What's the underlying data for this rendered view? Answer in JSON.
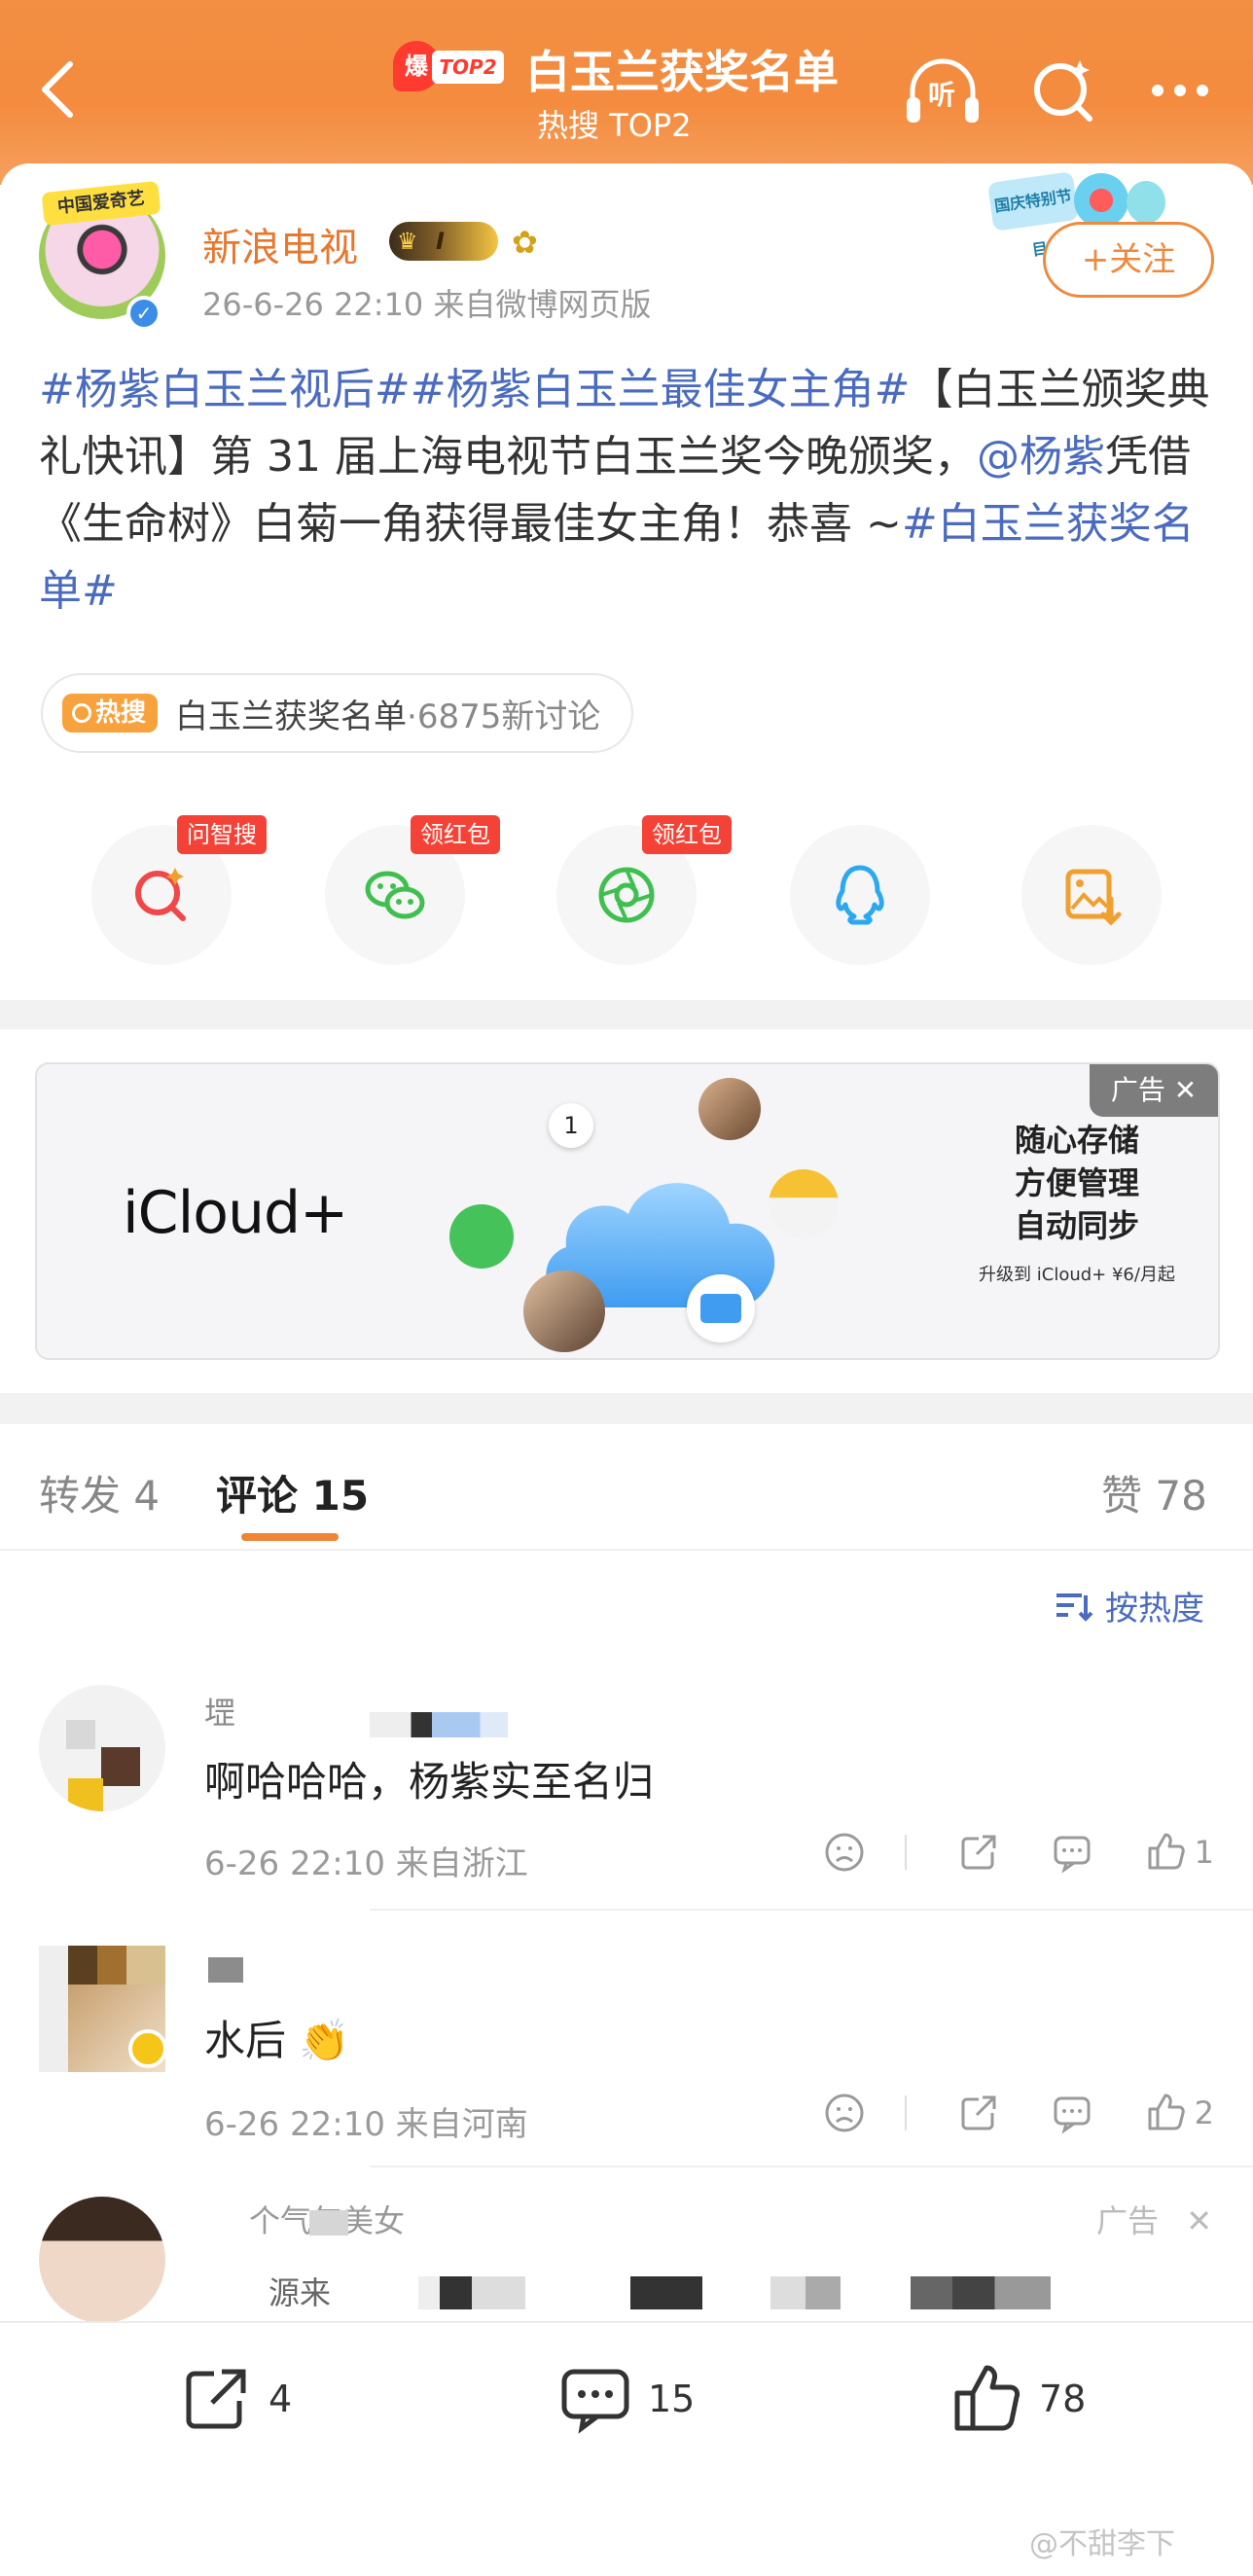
{
  "header": {
    "hot_badge": "爆",
    "hot_rank_tag": "TOP2",
    "title": "白玉兰获奖名单",
    "subtitle": "热搜 TOP2",
    "listen_label": "听"
  },
  "post": {
    "avatar_tag": "中国爱奇艺",
    "username": "新浪电视",
    "level": "I",
    "time_source": "26-6-26 22:10  来自微博网页版",
    "follow_label": "+关注",
    "sticker_text": "国庆特别节目",
    "text_segments": [
      {
        "type": "topic",
        "text": "#杨紫白玉兰视后#"
      },
      {
        "type": "topic",
        "text": "#杨紫白玉兰最佳女主角#"
      },
      {
        "type": "plain",
        "text": "【白玉兰颁奖典礼快讯】第 31 届上海电视节白玉兰奖今晚颁奖，"
      },
      {
        "type": "topic",
        "text": "@杨紫"
      },
      {
        "type": "plain",
        "text": "凭借《生命树》白菊一角获得最佳女主角！恭喜 ~"
      },
      {
        "type": "topic",
        "text": "#白玉兰获奖名单#"
      }
    ],
    "hot_chip": {
      "tag": "热搜",
      "text": "白玉兰获奖名单",
      "count": "·6875新讨论"
    }
  },
  "share_row": [
    {
      "icon": "ai-search-icon",
      "flag": "问智搜",
      "color": "#f04848"
    },
    {
      "icon": "wechat-icon",
      "flag": "领红包",
      "color": "#3fbf4f"
    },
    {
      "icon": "moments-icon",
      "flag": "领红包",
      "color": "#3fbf4f"
    },
    {
      "icon": "qq-icon",
      "flag": "",
      "color": "#2ba8f0"
    },
    {
      "icon": "save-image-icon",
      "flag": "",
      "color": "#f0a030"
    }
  ],
  "ad": {
    "logo": "iCloud+",
    "tag": "广告 ✕",
    "lines": [
      "随心存储",
      "方便管理",
      "自动同步"
    ],
    "sub": "升级到 iCloud+ ¥6/月起",
    "calendar_num": "1"
  },
  "tabs": {
    "repost": "转发 4",
    "comments": "评论 15",
    "likes": "赞 78"
  },
  "sort_label": "按热度",
  "comments": [
    {
      "name": "堽",
      "text": "啊哈哈哈，杨紫实至名归",
      "meta": "6-26 22:10  来自浙江",
      "likes": "1"
    },
    {
      "name": "",
      "text": "水后 👏",
      "meta": "6-26 22:10  来自河南",
      "likes": "2"
    },
    {
      "name": "个气年美女",
      "ad_tag": "广告",
      "name2": "源来"
    }
  ],
  "bottom": {
    "repost": "4",
    "comment": "15",
    "like": "78"
  },
  "watermark": "@不甜李下"
}
